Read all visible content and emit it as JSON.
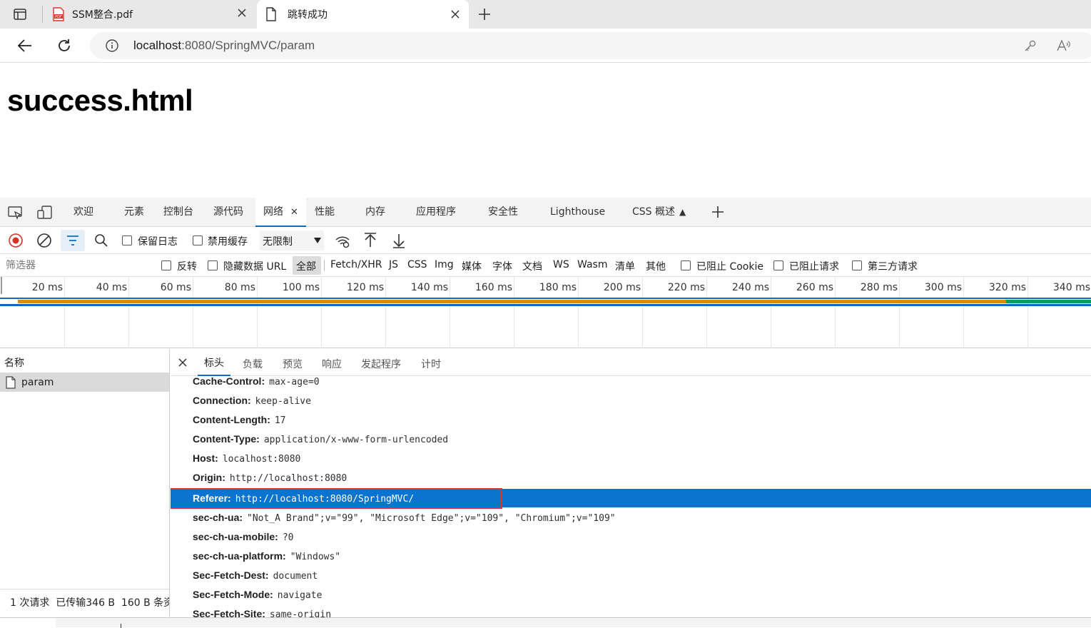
{
  "browser": {
    "tabs": [
      {
        "title": "SSM整合.pdf",
        "icon": "pdf-icon"
      },
      {
        "title": "跳转成功",
        "icon": "page-icon"
      }
    ],
    "url_host": "localhost",
    "url_rest": ":8080/SpringMVC/param"
  },
  "page": {
    "heading": "success.html"
  },
  "devtools": {
    "tabs": [
      "欢迎",
      "元素",
      "控制台",
      "源代码",
      "网络",
      "性能",
      "内存",
      "应用程序",
      "安全性",
      "Lighthouse",
      "CSS 概述"
    ],
    "active_tab": "网络",
    "toolbar": {
      "preserve_log": "保留日志",
      "disable_cache": "禁用缓存",
      "throttle": "无限制"
    },
    "filter": {
      "placeholder": "筛选器",
      "invert": "反转",
      "hide_data_urls": "隐藏数据 URL",
      "types": [
        "全部",
        "Fetch/XHR",
        "JS",
        "CSS",
        "Img",
        "媒体",
        "字体",
        "文档",
        "WS",
        "Wasm",
        "清单",
        "其他"
      ],
      "active_type": "全部",
      "blocked_cookies": "已阻止 Cookie",
      "blocked_requests": "已阻止请求",
      "third_party": "第三方请求"
    },
    "timeline_ticks": [
      "20 ms",
      "40 ms",
      "60 ms",
      "80 ms",
      "100 ms",
      "120 ms",
      "140 ms",
      "160 ms",
      "180 ms",
      "200 ms",
      "220 ms",
      "240 ms",
      "260 ms",
      "280 ms",
      "300 ms",
      "320 ms",
      "340 ms"
    ],
    "colors": {
      "wait": "#e58a00",
      "download": "#009e60",
      "accent": "#0f6cbd",
      "selected_row": "#0a74d0",
      "highlight_box": "#e03030"
    },
    "requests": {
      "column_name": "名称",
      "items": [
        "param"
      ],
      "summary": "1 次请求  已传输346 B  160 B 条资"
    },
    "details": {
      "tabs": [
        "标头",
        "负载",
        "预览",
        "响应",
        "发起程序",
        "计时"
      ],
      "active": "标头",
      "headers": [
        {
          "k": "Cache-Control:",
          "v": "max-age=0"
        },
        {
          "k": "Connection:",
          "v": "keep-alive"
        },
        {
          "k": "Content-Length:",
          "v": "17"
        },
        {
          "k": "Content-Type:",
          "v": "application/x-www-form-urlencoded"
        },
        {
          "k": "Host:",
          "v": "localhost:8080"
        },
        {
          "k": "Origin:",
          "v": "http://localhost:8080"
        },
        {
          "k": "Referer:",
          "v": "http://localhost:8080/SpringMVC/"
        },
        {
          "k": "sec-ch-ua:",
          "v": "\"Not_A Brand\";v=\"99\", \"Microsoft Edge\";v=\"109\", \"Chromium\";v=\"109\""
        },
        {
          "k": "sec-ch-ua-mobile:",
          "v": "?0"
        },
        {
          "k": "sec-ch-ua-platform:",
          "v": "\"Windows\""
        },
        {
          "k": "Sec-Fetch-Dest:",
          "v": "document"
        },
        {
          "k": "Sec-Fetch-Mode:",
          "v": "navigate"
        },
        {
          "k": "Sec-Fetch-Site:",
          "v": "same-origin"
        }
      ],
      "selected_header": "Referer:"
    }
  }
}
